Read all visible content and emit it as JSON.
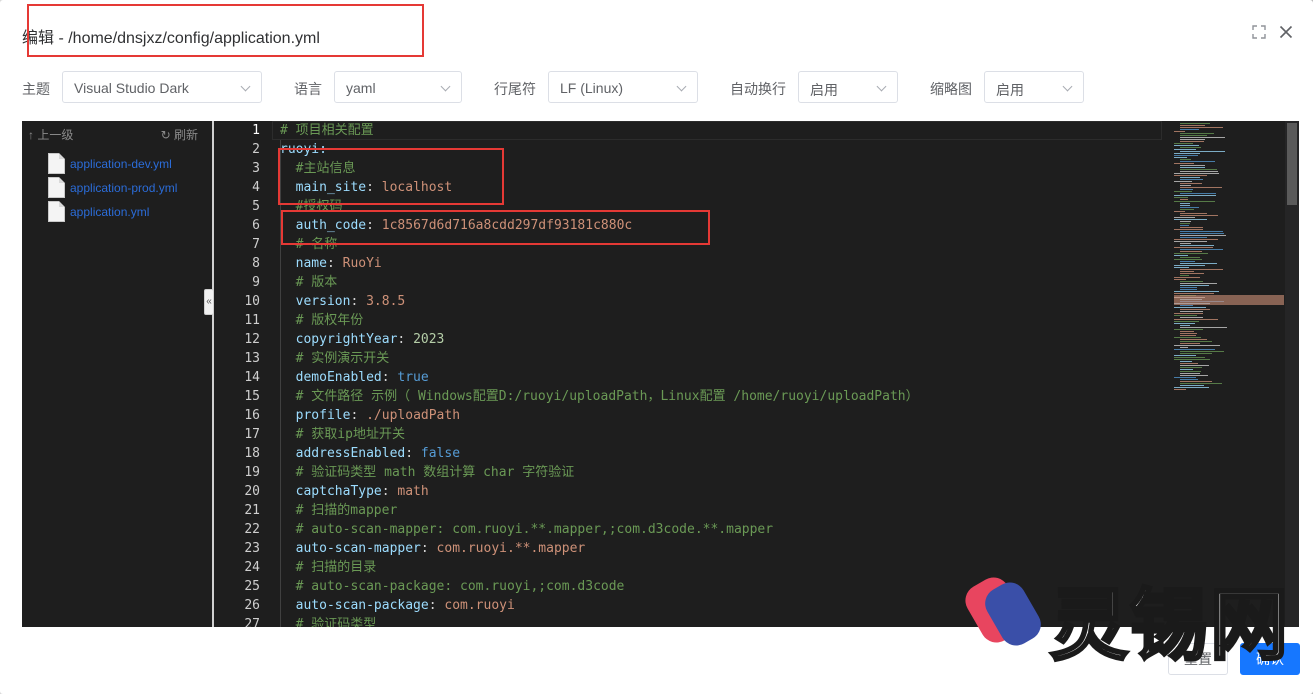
{
  "dialog": {
    "title": "编辑 - /home/dnsjxz/config/application.yml"
  },
  "toolbar": {
    "theme_label": "主题",
    "theme_value": "Visual Studio Dark",
    "language_label": "语言",
    "language_value": "yaml",
    "eol_label": "行尾符",
    "eol_value": "LF (Linux)",
    "wrap_label": "自动换行",
    "wrap_value": "启用",
    "minimap_label": "缩略图",
    "minimap_value": "启用"
  },
  "sidebar": {
    "up_label": "↑ 上一级",
    "refresh_label": "↻ 刷新",
    "files": [
      {
        "name": "application-dev.yml"
      },
      {
        "name": "application-prod.yml"
      },
      {
        "name": "application.yml"
      }
    ],
    "collapse_glyph": "«"
  },
  "code": {
    "lines": [
      {
        "n": "1",
        "t": "# 项目相关配置"
      },
      {
        "n": "2",
        "t": "ruoyi:"
      },
      {
        "n": "3",
        "t": "#主站信息"
      },
      {
        "n": "4",
        "k": "main_site",
        "v": "localhost",
        "vt": "str"
      },
      {
        "n": "5",
        "t": "#授权码"
      },
      {
        "n": "6",
        "k": "auth_code",
        "v": "1c8567d6d716a8cdd297df93181c880c",
        "vt": "str"
      },
      {
        "n": "7",
        "t": "# 名称"
      },
      {
        "n": "8",
        "k": "name",
        "v": "RuoYi",
        "vt": "str"
      },
      {
        "n": "9",
        "t": "# 版本"
      },
      {
        "n": "10",
        "k": "version",
        "v": "3.8.5",
        "vt": "str"
      },
      {
        "n": "11",
        "t": "# 版权年份"
      },
      {
        "n": "12",
        "k": "copyrightYear",
        "v": "2023",
        "vt": "num"
      },
      {
        "n": "13",
        "t": "# 实例演示开关"
      },
      {
        "n": "14",
        "k": "demoEnabled",
        "v": "true",
        "vt": "bool"
      },
      {
        "n": "15",
        "t": "# 文件路径 示例（ Windows配置D:/ruoyi/uploadPath，Linux配置 /home/ruoyi/uploadPath）"
      },
      {
        "n": "16",
        "k": "profile",
        "v": "./uploadPath",
        "vt": "str"
      },
      {
        "n": "17",
        "t": "# 获取ip地址开关"
      },
      {
        "n": "18",
        "k": "addressEnabled",
        "v": "false",
        "vt": "bool"
      },
      {
        "n": "19",
        "t": "# 验证码类型 math 数组计算 char 字符验证"
      },
      {
        "n": "20",
        "k": "captchaType",
        "v": "math",
        "vt": "str"
      },
      {
        "n": "21",
        "t": "# 扫描的mapper"
      },
      {
        "n": "22",
        "t": "# auto-scan-mapper: com.ruoyi.**.mapper,;com.d3code.**.mapper"
      },
      {
        "n": "23",
        "k": "auto-scan-mapper",
        "v": "com.ruoyi.**.mapper",
        "vt": "str"
      },
      {
        "n": "24",
        "t": "# 扫描的目录"
      },
      {
        "n": "25",
        "t": "# auto-scan-package: com.ruoyi,;com.d3code"
      },
      {
        "n": "26",
        "k": "auto-scan-package",
        "v": "com.ruoyi",
        "vt": "str"
      },
      {
        "n": "27",
        "t": "# 验证码类型"
      }
    ]
  },
  "watermark": {
    "text": "灵锡网"
  },
  "footer": {
    "reset_label": "重置",
    "ok_label": "确认"
  },
  "icons": {
    "fullscreen": "fullscreen-icon",
    "close": "close-icon"
  },
  "colors": {
    "editor_bg": "#1e1e1e",
    "highlight": "#e53935",
    "primary": "#1677ff"
  }
}
